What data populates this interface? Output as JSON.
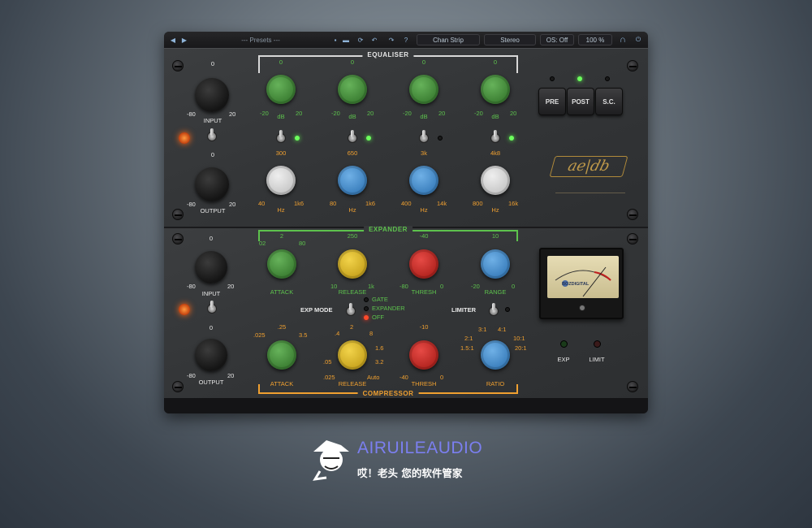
{
  "toolbar": {
    "prev_icon": "triangle-left",
    "next_icon": "triangle-right",
    "presets_label": "--- Presets ---",
    "chain": "Chan Strip",
    "mode": "Stereo",
    "os": "OS: Off",
    "zoom": "100 %"
  },
  "equaliser": {
    "title": "EQUALISER",
    "gain_knobs": [
      {
        "top": "0",
        "min": "-20",
        "unit": "dB",
        "max": "20"
      },
      {
        "top": "0",
        "min": "-20",
        "unit": "dB",
        "max": "20"
      },
      {
        "top": "0",
        "min": "-20",
        "unit": "dB",
        "max": "20"
      },
      {
        "top": "0",
        "min": "-20",
        "unit": "dB",
        "max": "20"
      }
    ],
    "freq_knobs": [
      {
        "top": "300",
        "min": "40",
        "unit": "Hz",
        "max": "1k6"
      },
      {
        "top": "650",
        "min": "80",
        "unit": "Hz",
        "max": "1k6"
      },
      {
        "top": "3k",
        "min": "400",
        "unit": "Hz",
        "max": "14k"
      },
      {
        "top": "4k8",
        "min": "800",
        "unit": "Hz",
        "max": "16k"
      }
    ],
    "buttons": [
      "PRE",
      "POST",
      "S.C."
    ]
  },
  "io_top": {
    "input": {
      "label": "INPUT",
      "top": "0",
      "min": "-80",
      "max": "20"
    },
    "output": {
      "label": "OUTPUT",
      "top": "0",
      "min": "-80",
      "max": "20"
    }
  },
  "io_bottom": {
    "input": {
      "label": "INPUT",
      "top": "0",
      "min": "-80",
      "max": "20"
    },
    "output": {
      "label": "OUTPUT",
      "top": "0",
      "min": "-80",
      "max": "20"
    }
  },
  "expander": {
    "title": "EXPANDER",
    "attack": {
      "label": "ATTACK",
      "top": "2",
      "left": "02",
      "right": "80"
    },
    "release": {
      "label": "RELEASE",
      "top": "250",
      "left": "10",
      "right": "1k"
    },
    "thresh": {
      "label": "THRESH",
      "top": "-40",
      "left": "-80",
      "right": "0"
    },
    "range": {
      "label": "RANGE",
      "top": "10",
      "left": "-20",
      "right": "0"
    },
    "mode_label": "EXP MODE",
    "mode_options": [
      "GATE",
      "EXPANDER",
      "OFF"
    ],
    "limiter_label": "LIMITER"
  },
  "compressor": {
    "title": "COMPRESSOR",
    "attack": {
      "label": "ATTACK",
      "top": ".25",
      "left": ".025",
      "right": "3.5"
    },
    "release": {
      "label": "RELEASE",
      "ticks": [
        ".4",
        "2",
        "8",
        "1.6",
        ".05",
        "3.2",
        ".025",
        "Auto"
      ]
    },
    "thresh": {
      "label": "THRESH",
      "top": "-10",
      "left": "-40",
      "right": "0"
    },
    "ratio": {
      "label": "RATIO",
      "ticks": [
        "3:1",
        "4:1",
        "2:1",
        "10:1",
        "1.5:1",
        "20:1"
      ]
    }
  },
  "meter": {
    "brand": "BOZDIGITAL",
    "indicators": [
      "EXP",
      "LIMIT"
    ]
  },
  "watermark": {
    "brand": "AIRUILEAUDIO",
    "tagline": "哎！老头 您的软件管家"
  },
  "colors": {
    "accent_orange": "#f0a030",
    "accent_green": "#5dc24d",
    "brand_purple": "#7b7ff0"
  }
}
